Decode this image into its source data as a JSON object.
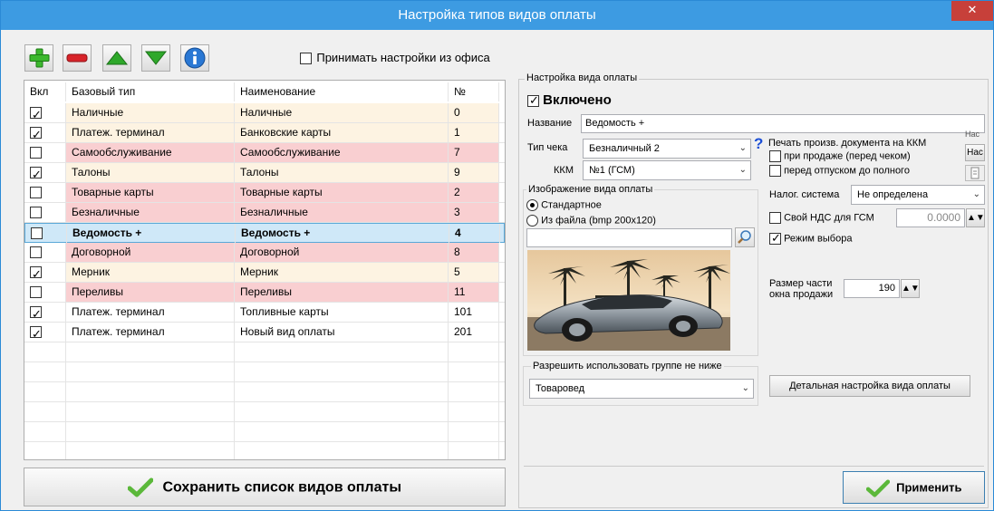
{
  "window": {
    "title": "Настройка типов видов оплаты",
    "close_glyph": "✕"
  },
  "toolbar": {
    "icons": [
      "add-icon",
      "remove-icon",
      "move-up-icon",
      "move-down-icon",
      "info-icon"
    ],
    "accept_office_label": "Принимать настройки из офиса",
    "accept_office_checked": false
  },
  "grid": {
    "headers": [
      "Вкл",
      "Базовый тип",
      "Наименование",
      "№"
    ],
    "rows": [
      {
        "on": true,
        "base": "Наличные",
        "name": "Наличные",
        "num": "0",
        "style": "cream"
      },
      {
        "on": true,
        "base": "Платеж. терминал",
        "name": "Банковские карты",
        "num": "1",
        "style": "cream"
      },
      {
        "on": false,
        "base": "Самообслуживание",
        "name": "Самообслуживание",
        "num": "7",
        "style": "pink"
      },
      {
        "on": true,
        "base": "Талоны",
        "name": "Талоны",
        "num": "9",
        "style": "cream"
      },
      {
        "on": false,
        "base": "Товарные карты",
        "name": "Товарные карты",
        "num": "2",
        "style": "pink"
      },
      {
        "on": false,
        "base": "Безналичные",
        "name": "Безналичные",
        "num": "3",
        "style": "pink"
      },
      {
        "on": false,
        "base": "Ведомость +",
        "name": "Ведомость +",
        "num": "4",
        "style": "sel"
      },
      {
        "on": false,
        "base": "Договорной",
        "name": "Договорной",
        "num": "8",
        "style": "pink"
      },
      {
        "on": true,
        "base": "Мерник",
        "name": "Мерник",
        "num": "5",
        "style": "cream"
      },
      {
        "on": false,
        "base": "Переливы",
        "name": "Переливы",
        "num": "11",
        "style": "pink"
      },
      {
        "on": true,
        "base": "Платеж. терминал",
        "name": "Топливные карты",
        "num": "101",
        "style": "plain"
      },
      {
        "on": true,
        "base": "Платеж. терминал",
        "name": "Новый вид оплаты",
        "num": "201",
        "style": "plain"
      }
    ]
  },
  "save_button": {
    "label": "Сохранить список видов оплаты"
  },
  "panel": {
    "legend": "Настройка вида оплаты",
    "enabled_label": "Включено",
    "enabled_checked": true,
    "name_label": "Название",
    "name_value": "Ведомость +",
    "receipt_type_label": "Тип чека",
    "receipt_type_value": "Безналичный 2",
    "help_glyph": "?",
    "kkm_label": "ККМ",
    "kkm_value": "№1 (ГСМ)",
    "print_doc_label": "Печать произв. документа на ККМ",
    "print_on_sale_label": "при продаже (перед чеком)",
    "print_before_full_label": "перед отпуском до полного",
    "nac_label_1": "Нас",
    "nac_label_2": "Нас",
    "image_legend": "Изображение вида оплаты",
    "image_standard_label": "Стандартное",
    "image_file_label": "Из файла (bmp 200х120)",
    "image_path_value": "",
    "tax_system_label": "Налог. система",
    "tax_system_value": "Не определена",
    "own_vat_label": "Свой НДС для ГСМ",
    "own_vat_value": "0.0000",
    "select_mode_label": "Режим выбора",
    "select_mode_checked": true,
    "part_size_label_1": "Размер части",
    "part_size_label_2": "окна продажи",
    "part_size_value": "190",
    "group_legend": "Разрешить использовать группе не ниже",
    "group_value": "Товаровед",
    "detail_button_label": "Детальная настройка вида оплаты",
    "apply_button_label": "Применить"
  },
  "colors": {
    "title_bar": "#3d9be2",
    "close": "#c7403a",
    "pink_row": "#f9cfd1",
    "cream_row": "#fdf3e2",
    "selected_row": "#cfe8f8",
    "check_green": "#5bb83a"
  }
}
